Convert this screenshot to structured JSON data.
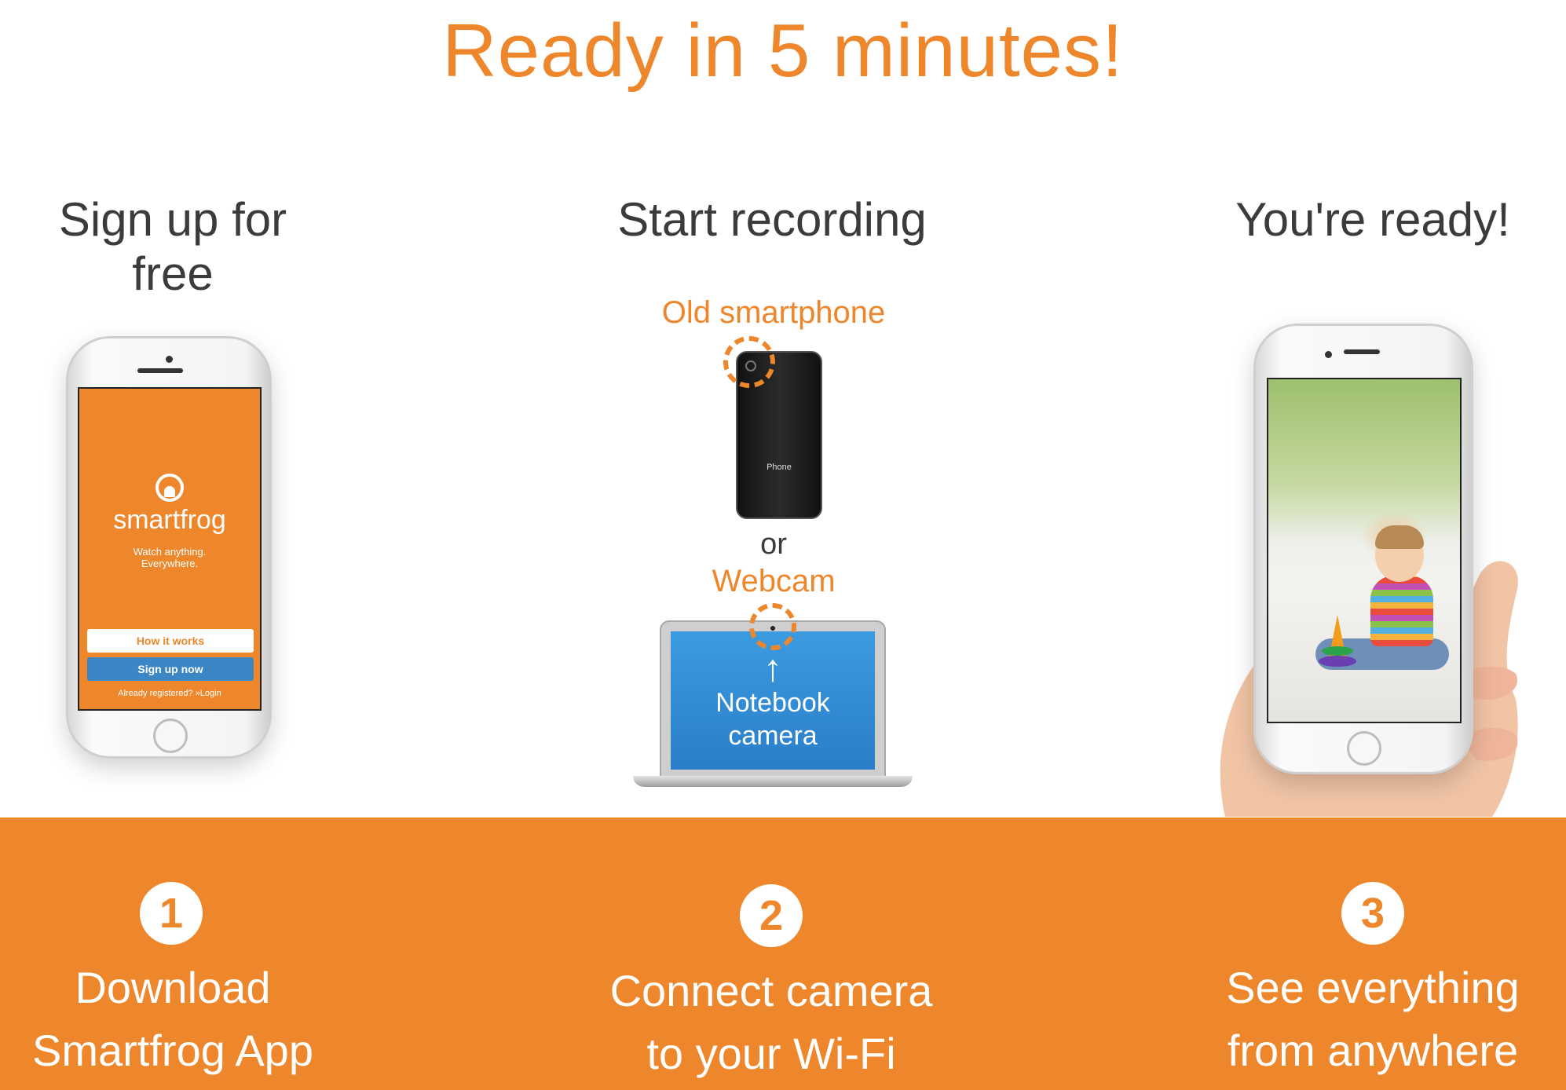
{
  "headline": "Ready in 5 minutes!",
  "columns": [
    {
      "title": "Sign up for free"
    },
    {
      "title": "Start recording"
    },
    {
      "title": "You're ready!"
    }
  ],
  "phone1": {
    "brand": "smartfrog",
    "tagline": "Watch anything.\nEverywhere.",
    "how_it_works": "How it works",
    "sign_up": "Sign up now",
    "login": "Already registered? »Login"
  },
  "recording": {
    "old_smartphone": "Old smartphone",
    "phone_label": "Phone",
    "or": "or",
    "webcam": "Webcam",
    "notebook": "Notebook\ncamera"
  },
  "steps": [
    {
      "number": "1",
      "text": "Download\nSmartfrog App"
    },
    {
      "number": "2",
      "text": "Connect camera\nto your Wi-Fi"
    },
    {
      "number": "3",
      "text": "See everything\nfrom anywhere"
    }
  ],
  "colors": {
    "accent": "#ee862b",
    "blue": "#3d86c6",
    "text": "#3b3b3b"
  }
}
